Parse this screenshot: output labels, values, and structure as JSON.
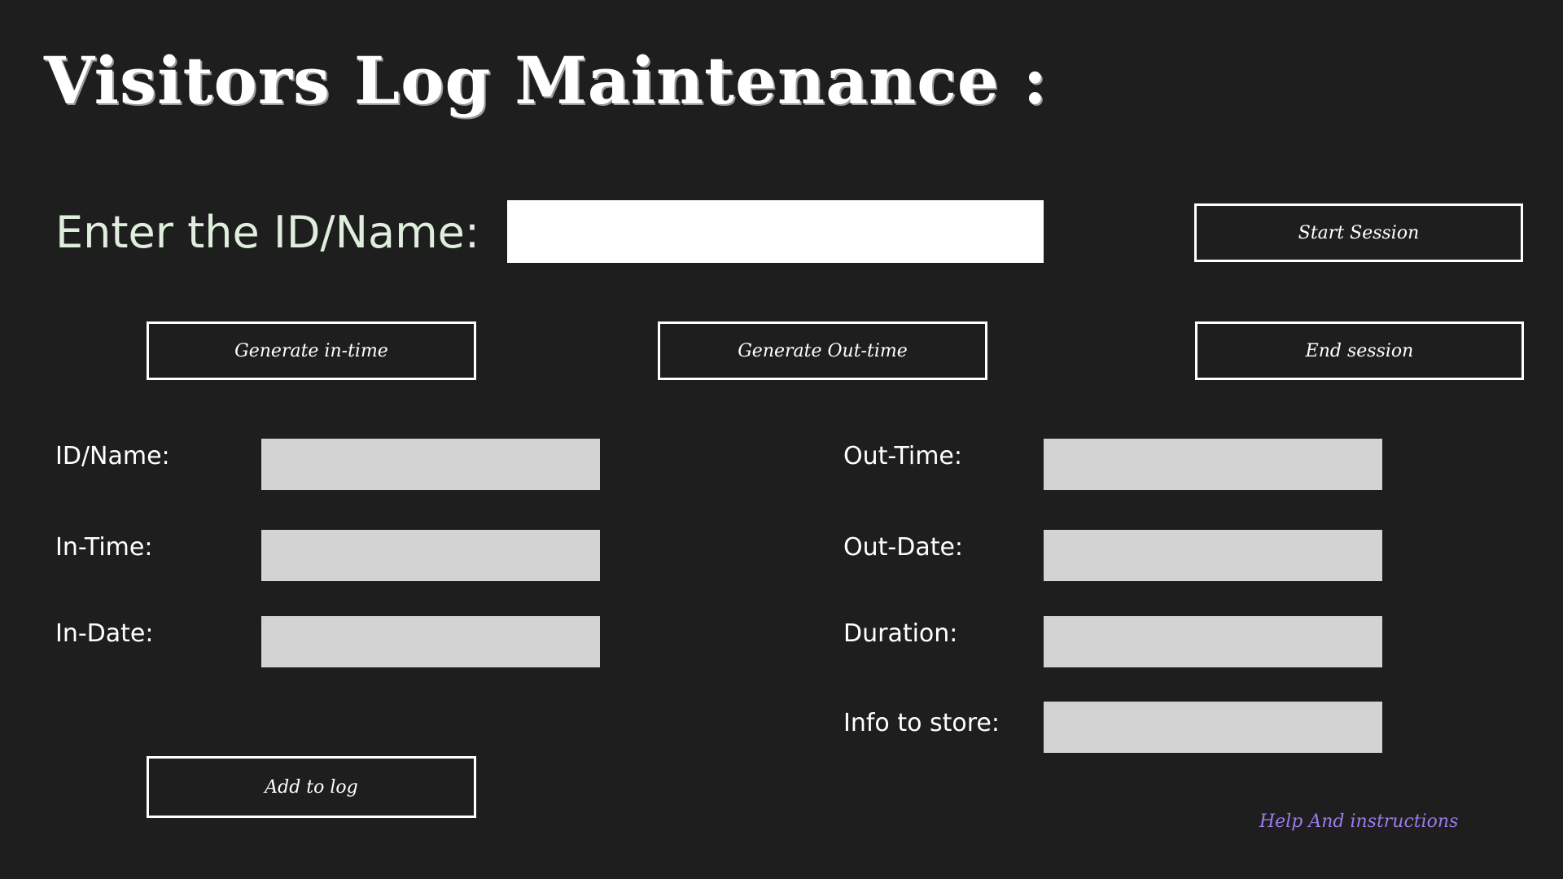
{
  "header": {
    "title": "Visitors Log Maintenance :"
  },
  "entry": {
    "label": "Enter the ID/Name:",
    "value": "",
    "placeholder": ""
  },
  "buttons": {
    "start_session": "Start Session",
    "generate_in_time": "Generate in-time",
    "generate_out_time": "Generate Out-time",
    "end_session": "End session",
    "add_to_log": "Add to log"
  },
  "fields": {
    "id_name": {
      "label": "ID/Name:",
      "value": ""
    },
    "in_time": {
      "label": "In-Time:",
      "value": ""
    },
    "in_date": {
      "label": "In-Date:",
      "value": ""
    },
    "out_time": {
      "label": "Out-Time:",
      "value": ""
    },
    "out_date": {
      "label": "Out-Date:",
      "value": ""
    },
    "duration": {
      "label": "Duration:",
      "value": ""
    },
    "info_to_store": {
      "label": "Info to store:",
      "value": ""
    }
  },
  "help": {
    "link_text": "Help And instructions"
  },
  "colors": {
    "background": "#1e1e1e",
    "input_white": "#ffffff",
    "field_gray": "#d3d3d3",
    "button_border": "#ffffff",
    "entry_label": "#dfeedd",
    "help_link": "#9b7bea"
  }
}
